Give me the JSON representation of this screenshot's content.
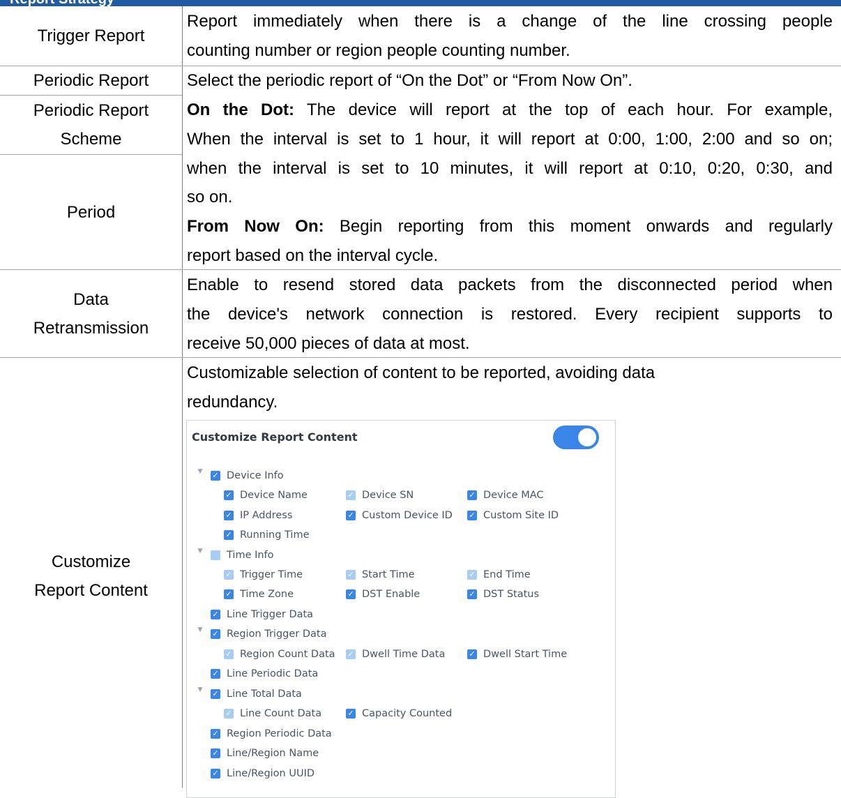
{
  "header": {
    "title": "Report Strategy"
  },
  "rows": {
    "trigger_report": {
      "label": "Trigger Report",
      "desc_lines": [
        "Report immediately when there is a change of the line crossing people",
        "counting number or region people counting number."
      ]
    },
    "periodic_report": {
      "label": "Periodic Report",
      "desc": "Select the periodic report of “On the Dot” or “From Now On”."
    },
    "periodic_scheme": {
      "label_lines": [
        "Periodic Report",
        "Scheme"
      ]
    },
    "period": {
      "label": "Period"
    },
    "scheme_desc": {
      "on_dot_term": "On the Dot:",
      "on_dot_lines": [
        " The device will report at the top of each hour. For example,",
        "When the interval is set to 1 hour, it will report at 0:00, 1:00, 2:00 and so on;",
        "when the interval is set to 10 minutes, it will report at 0:10, 0:20, 0:30, and",
        "so on."
      ],
      "from_now_term": "From Now On:",
      "from_now_lines": [
        " Begin reporting from this moment onwards and regularly",
        "report based on the interval cycle."
      ]
    },
    "data_retransmission": {
      "label_lines": [
        "Data",
        "Retransmission"
      ],
      "desc_lines": [
        "Enable to resend stored data packets from the disconnected period when",
        "the device's network connection is restored. Every recipient supports to",
        "receive 50,000 pieces of data at most."
      ]
    },
    "customize_report": {
      "label_lines": [
        "Customize",
        "Report Content"
      ],
      "desc_lines": [
        "Customizable selection of content to be reported, avoiding data",
        "redundancy."
      ]
    }
  },
  "panel": {
    "title": "Customize Report Content",
    "toggle_on": true,
    "tree": {
      "device_info": "Device Info",
      "device_name": "Device Name",
      "device_sn": "Device SN",
      "device_mac": "Device MAC",
      "ip_address": "IP Address",
      "custom_device_id": "Custom Device ID",
      "custom_site_id": "Custom Site ID",
      "running_time": "Running Time",
      "time_info": "Time Info",
      "trigger_time": "Trigger Time",
      "start_time": "Start Time",
      "end_time": "End Time",
      "time_zone": "Time Zone",
      "dst_enable": "DST Enable",
      "dst_status": "DST Status",
      "line_trigger_data": "Line Trigger Data",
      "region_trigger_data": "Region Trigger Data",
      "region_count_data": "Region Count Data",
      "dwell_time_data": "Dwell Time Data",
      "dwell_start_time": "Dwell Start Time",
      "line_periodic_data": "Line Periodic Data",
      "line_total_data": "Line Total Data",
      "line_count_data": "Line Count Data",
      "capacity_counted": "Capacity Counted",
      "region_periodic_data": "Region Periodic Data",
      "line_region_name": "Line/Region Name",
      "line_region_uuid": "Line/Region UUID"
    }
  }
}
